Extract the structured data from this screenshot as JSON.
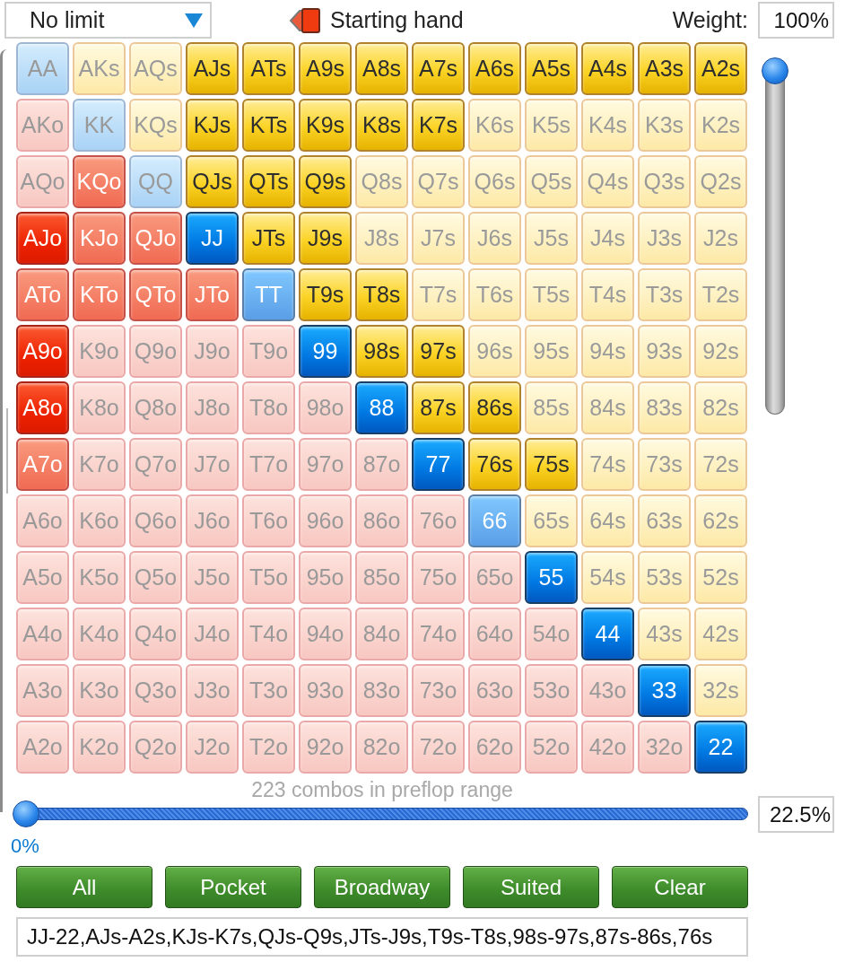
{
  "toolbar": {
    "game_dropdown": {
      "value": "No limit"
    },
    "title": "Starting hand",
    "weight": {
      "label": "Weight:",
      "value": "100%"
    }
  },
  "hand_grid": [
    [
      {
        "hand": "AA",
        "kind": "pair",
        "selected": false,
        "partial": false
      },
      {
        "hand": "AKs",
        "kind": "suited",
        "selected": false,
        "partial": false
      },
      {
        "hand": "AQs",
        "kind": "suited",
        "selected": false,
        "partial": false
      },
      {
        "hand": "AJs",
        "kind": "suited",
        "selected": true,
        "partial": false
      },
      {
        "hand": "ATs",
        "kind": "suited",
        "selected": true,
        "partial": false
      },
      {
        "hand": "A9s",
        "kind": "suited",
        "selected": true,
        "partial": false
      },
      {
        "hand": "A8s",
        "kind": "suited",
        "selected": true,
        "partial": false
      },
      {
        "hand": "A7s",
        "kind": "suited",
        "selected": true,
        "partial": false
      },
      {
        "hand": "A6s",
        "kind": "suited",
        "selected": true,
        "partial": false
      },
      {
        "hand": "A5s",
        "kind": "suited",
        "selected": true,
        "partial": false
      },
      {
        "hand": "A4s",
        "kind": "suited",
        "selected": true,
        "partial": false
      },
      {
        "hand": "A3s",
        "kind": "suited",
        "selected": true,
        "partial": false
      },
      {
        "hand": "A2s",
        "kind": "suited",
        "selected": true,
        "partial": false
      }
    ],
    [
      {
        "hand": "AKo",
        "kind": "offsuit",
        "selected": false,
        "partial": false
      },
      {
        "hand": "KK",
        "kind": "pair",
        "selected": false,
        "partial": false
      },
      {
        "hand": "KQs",
        "kind": "suited",
        "selected": false,
        "partial": false
      },
      {
        "hand": "KJs",
        "kind": "suited",
        "selected": true,
        "partial": false
      },
      {
        "hand": "KTs",
        "kind": "suited",
        "selected": true,
        "partial": false
      },
      {
        "hand": "K9s",
        "kind": "suited",
        "selected": true,
        "partial": false
      },
      {
        "hand": "K8s",
        "kind": "suited",
        "selected": true,
        "partial": false
      },
      {
        "hand": "K7s",
        "kind": "suited",
        "selected": true,
        "partial": false
      },
      {
        "hand": "K6s",
        "kind": "suited",
        "selected": false,
        "partial": false
      },
      {
        "hand": "K5s",
        "kind": "suited",
        "selected": false,
        "partial": false
      },
      {
        "hand": "K4s",
        "kind": "suited",
        "selected": false,
        "partial": false
      },
      {
        "hand": "K3s",
        "kind": "suited",
        "selected": false,
        "partial": false
      },
      {
        "hand": "K2s",
        "kind": "suited",
        "selected": false,
        "partial": false
      }
    ],
    [
      {
        "hand": "AQo",
        "kind": "offsuit",
        "selected": false,
        "partial": false
      },
      {
        "hand": "KQo",
        "kind": "offsuit",
        "selected": false,
        "partial": true
      },
      {
        "hand": "QQ",
        "kind": "pair",
        "selected": false,
        "partial": false
      },
      {
        "hand": "QJs",
        "kind": "suited",
        "selected": true,
        "partial": false
      },
      {
        "hand": "QTs",
        "kind": "suited",
        "selected": true,
        "partial": false
      },
      {
        "hand": "Q9s",
        "kind": "suited",
        "selected": true,
        "partial": false
      },
      {
        "hand": "Q8s",
        "kind": "suited",
        "selected": false,
        "partial": false
      },
      {
        "hand": "Q7s",
        "kind": "suited",
        "selected": false,
        "partial": false
      },
      {
        "hand": "Q6s",
        "kind": "suited",
        "selected": false,
        "partial": false
      },
      {
        "hand": "Q5s",
        "kind": "suited",
        "selected": false,
        "partial": false
      },
      {
        "hand": "Q4s",
        "kind": "suited",
        "selected": false,
        "partial": false
      },
      {
        "hand": "Q3s",
        "kind": "suited",
        "selected": false,
        "partial": false
      },
      {
        "hand": "Q2s",
        "kind": "suited",
        "selected": false,
        "partial": false
      }
    ],
    [
      {
        "hand": "AJo",
        "kind": "offsuit",
        "selected": true,
        "partial": false
      },
      {
        "hand": "KJo",
        "kind": "offsuit",
        "selected": false,
        "partial": true
      },
      {
        "hand": "QJo",
        "kind": "offsuit",
        "selected": false,
        "partial": true
      },
      {
        "hand": "JJ",
        "kind": "pair",
        "selected": true,
        "partial": false
      },
      {
        "hand": "JTs",
        "kind": "suited",
        "selected": true,
        "partial": false
      },
      {
        "hand": "J9s",
        "kind": "suited",
        "selected": true,
        "partial": false
      },
      {
        "hand": "J8s",
        "kind": "suited",
        "selected": false,
        "partial": false
      },
      {
        "hand": "J7s",
        "kind": "suited",
        "selected": false,
        "partial": false
      },
      {
        "hand": "J6s",
        "kind": "suited",
        "selected": false,
        "partial": false
      },
      {
        "hand": "J5s",
        "kind": "suited",
        "selected": false,
        "partial": false
      },
      {
        "hand": "J4s",
        "kind": "suited",
        "selected": false,
        "partial": false
      },
      {
        "hand": "J3s",
        "kind": "suited",
        "selected": false,
        "partial": false
      },
      {
        "hand": "J2s",
        "kind": "suited",
        "selected": false,
        "partial": false
      }
    ],
    [
      {
        "hand": "ATo",
        "kind": "offsuit",
        "selected": false,
        "partial": true
      },
      {
        "hand": "KTo",
        "kind": "offsuit",
        "selected": false,
        "partial": true
      },
      {
        "hand": "QTo",
        "kind": "offsuit",
        "selected": false,
        "partial": true
      },
      {
        "hand": "JTo",
        "kind": "offsuit",
        "selected": false,
        "partial": true
      },
      {
        "hand": "TT",
        "kind": "pair",
        "selected": false,
        "partial": true
      },
      {
        "hand": "T9s",
        "kind": "suited",
        "selected": true,
        "partial": false
      },
      {
        "hand": "T8s",
        "kind": "suited",
        "selected": true,
        "partial": false
      },
      {
        "hand": "T7s",
        "kind": "suited",
        "selected": false,
        "partial": false
      },
      {
        "hand": "T6s",
        "kind": "suited",
        "selected": false,
        "partial": false
      },
      {
        "hand": "T5s",
        "kind": "suited",
        "selected": false,
        "partial": false
      },
      {
        "hand": "T4s",
        "kind": "suited",
        "selected": false,
        "partial": false
      },
      {
        "hand": "T3s",
        "kind": "suited",
        "selected": false,
        "partial": false
      },
      {
        "hand": "T2s",
        "kind": "suited",
        "selected": false,
        "partial": false
      }
    ],
    [
      {
        "hand": "A9o",
        "kind": "offsuit",
        "selected": true,
        "partial": false
      },
      {
        "hand": "K9o",
        "kind": "offsuit",
        "selected": false,
        "partial": false
      },
      {
        "hand": "Q9o",
        "kind": "offsuit",
        "selected": false,
        "partial": false
      },
      {
        "hand": "J9o",
        "kind": "offsuit",
        "selected": false,
        "partial": false
      },
      {
        "hand": "T9o",
        "kind": "offsuit",
        "selected": false,
        "partial": false
      },
      {
        "hand": "99",
        "kind": "pair",
        "selected": true,
        "partial": false
      },
      {
        "hand": "98s",
        "kind": "suited",
        "selected": true,
        "partial": false
      },
      {
        "hand": "97s",
        "kind": "suited",
        "selected": true,
        "partial": false
      },
      {
        "hand": "96s",
        "kind": "suited",
        "selected": false,
        "partial": false
      },
      {
        "hand": "95s",
        "kind": "suited",
        "selected": false,
        "partial": false
      },
      {
        "hand": "94s",
        "kind": "suited",
        "selected": false,
        "partial": false
      },
      {
        "hand": "93s",
        "kind": "suited",
        "selected": false,
        "partial": false
      },
      {
        "hand": "92s",
        "kind": "suited",
        "selected": false,
        "partial": false
      }
    ],
    [
      {
        "hand": "A8o",
        "kind": "offsuit",
        "selected": true,
        "partial": false
      },
      {
        "hand": "K8o",
        "kind": "offsuit",
        "selected": false,
        "partial": false
      },
      {
        "hand": "Q8o",
        "kind": "offsuit",
        "selected": false,
        "partial": false
      },
      {
        "hand": "J8o",
        "kind": "offsuit",
        "selected": false,
        "partial": false
      },
      {
        "hand": "T8o",
        "kind": "offsuit",
        "selected": false,
        "partial": false
      },
      {
        "hand": "98o",
        "kind": "offsuit",
        "selected": false,
        "partial": false
      },
      {
        "hand": "88",
        "kind": "pair",
        "selected": true,
        "partial": false
      },
      {
        "hand": "87s",
        "kind": "suited",
        "selected": true,
        "partial": false
      },
      {
        "hand": "86s",
        "kind": "suited",
        "selected": true,
        "partial": false
      },
      {
        "hand": "85s",
        "kind": "suited",
        "selected": false,
        "partial": false
      },
      {
        "hand": "84s",
        "kind": "suited",
        "selected": false,
        "partial": false
      },
      {
        "hand": "83s",
        "kind": "suited",
        "selected": false,
        "partial": false
      },
      {
        "hand": "82s",
        "kind": "suited",
        "selected": false,
        "partial": false
      }
    ],
    [
      {
        "hand": "A7o",
        "kind": "offsuit",
        "selected": false,
        "partial": true
      },
      {
        "hand": "K7o",
        "kind": "offsuit",
        "selected": false,
        "partial": false
      },
      {
        "hand": "Q7o",
        "kind": "offsuit",
        "selected": false,
        "partial": false
      },
      {
        "hand": "J7o",
        "kind": "offsuit",
        "selected": false,
        "partial": false
      },
      {
        "hand": "T7o",
        "kind": "offsuit",
        "selected": false,
        "partial": false
      },
      {
        "hand": "97o",
        "kind": "offsuit",
        "selected": false,
        "partial": false
      },
      {
        "hand": "87o",
        "kind": "offsuit",
        "selected": false,
        "partial": false
      },
      {
        "hand": "77",
        "kind": "pair",
        "selected": true,
        "partial": false
      },
      {
        "hand": "76s",
        "kind": "suited",
        "selected": true,
        "partial": false
      },
      {
        "hand": "75s",
        "kind": "suited",
        "selected": true,
        "partial": false
      },
      {
        "hand": "74s",
        "kind": "suited",
        "selected": false,
        "partial": false
      },
      {
        "hand": "73s",
        "kind": "suited",
        "selected": false,
        "partial": false
      },
      {
        "hand": "72s",
        "kind": "suited",
        "selected": false,
        "partial": false
      }
    ],
    [
      {
        "hand": "A6o",
        "kind": "offsuit",
        "selected": false,
        "partial": false
      },
      {
        "hand": "K6o",
        "kind": "offsuit",
        "selected": false,
        "partial": false
      },
      {
        "hand": "Q6o",
        "kind": "offsuit",
        "selected": false,
        "partial": false
      },
      {
        "hand": "J6o",
        "kind": "offsuit",
        "selected": false,
        "partial": false
      },
      {
        "hand": "T6o",
        "kind": "offsuit",
        "selected": false,
        "partial": false
      },
      {
        "hand": "96o",
        "kind": "offsuit",
        "selected": false,
        "partial": false
      },
      {
        "hand": "86o",
        "kind": "offsuit",
        "selected": false,
        "partial": false
      },
      {
        "hand": "76o",
        "kind": "offsuit",
        "selected": false,
        "partial": false
      },
      {
        "hand": "66",
        "kind": "pair",
        "selected": false,
        "partial": true
      },
      {
        "hand": "65s",
        "kind": "suited",
        "selected": false,
        "partial": false
      },
      {
        "hand": "64s",
        "kind": "suited",
        "selected": false,
        "partial": false
      },
      {
        "hand": "63s",
        "kind": "suited",
        "selected": false,
        "partial": false
      },
      {
        "hand": "62s",
        "kind": "suited",
        "selected": false,
        "partial": false
      }
    ],
    [
      {
        "hand": "A5o",
        "kind": "offsuit",
        "selected": false,
        "partial": false
      },
      {
        "hand": "K5o",
        "kind": "offsuit",
        "selected": false,
        "partial": false
      },
      {
        "hand": "Q5o",
        "kind": "offsuit",
        "selected": false,
        "partial": false
      },
      {
        "hand": "J5o",
        "kind": "offsuit",
        "selected": false,
        "partial": false
      },
      {
        "hand": "T5o",
        "kind": "offsuit",
        "selected": false,
        "partial": false
      },
      {
        "hand": "95o",
        "kind": "offsuit",
        "selected": false,
        "partial": false
      },
      {
        "hand": "85o",
        "kind": "offsuit",
        "selected": false,
        "partial": false
      },
      {
        "hand": "75o",
        "kind": "offsuit",
        "selected": false,
        "partial": false
      },
      {
        "hand": "65o",
        "kind": "offsuit",
        "selected": false,
        "partial": false
      },
      {
        "hand": "55",
        "kind": "pair",
        "selected": true,
        "partial": false
      },
      {
        "hand": "54s",
        "kind": "suited",
        "selected": false,
        "partial": false
      },
      {
        "hand": "53s",
        "kind": "suited",
        "selected": false,
        "partial": false
      },
      {
        "hand": "52s",
        "kind": "suited",
        "selected": false,
        "partial": false
      }
    ],
    [
      {
        "hand": "A4o",
        "kind": "offsuit",
        "selected": false,
        "partial": false
      },
      {
        "hand": "K4o",
        "kind": "offsuit",
        "selected": false,
        "partial": false
      },
      {
        "hand": "Q4o",
        "kind": "offsuit",
        "selected": false,
        "partial": false
      },
      {
        "hand": "J4o",
        "kind": "offsuit",
        "selected": false,
        "partial": false
      },
      {
        "hand": "T4o",
        "kind": "offsuit",
        "selected": false,
        "partial": false
      },
      {
        "hand": "94o",
        "kind": "offsuit",
        "selected": false,
        "partial": false
      },
      {
        "hand": "84o",
        "kind": "offsuit",
        "selected": false,
        "partial": false
      },
      {
        "hand": "74o",
        "kind": "offsuit",
        "selected": false,
        "partial": false
      },
      {
        "hand": "64o",
        "kind": "offsuit",
        "selected": false,
        "partial": false
      },
      {
        "hand": "54o",
        "kind": "offsuit",
        "selected": false,
        "partial": false
      },
      {
        "hand": "44",
        "kind": "pair",
        "selected": true,
        "partial": false
      },
      {
        "hand": "43s",
        "kind": "suited",
        "selected": false,
        "partial": false
      },
      {
        "hand": "42s",
        "kind": "suited",
        "selected": false,
        "partial": false
      }
    ],
    [
      {
        "hand": "A3o",
        "kind": "offsuit",
        "selected": false,
        "partial": false
      },
      {
        "hand": "K3o",
        "kind": "offsuit",
        "selected": false,
        "partial": false
      },
      {
        "hand": "Q3o",
        "kind": "offsuit",
        "selected": false,
        "partial": false
      },
      {
        "hand": "J3o",
        "kind": "offsuit",
        "selected": false,
        "partial": false
      },
      {
        "hand": "T3o",
        "kind": "offsuit",
        "selected": false,
        "partial": false
      },
      {
        "hand": "93o",
        "kind": "offsuit",
        "selected": false,
        "partial": false
      },
      {
        "hand": "83o",
        "kind": "offsuit",
        "selected": false,
        "partial": false
      },
      {
        "hand": "73o",
        "kind": "offsuit",
        "selected": false,
        "partial": false
      },
      {
        "hand": "63o",
        "kind": "offsuit",
        "selected": false,
        "partial": false
      },
      {
        "hand": "53o",
        "kind": "offsuit",
        "selected": false,
        "partial": false
      },
      {
        "hand": "43o",
        "kind": "offsuit",
        "selected": false,
        "partial": false
      },
      {
        "hand": "33",
        "kind": "pair",
        "selected": true,
        "partial": false
      },
      {
        "hand": "32s",
        "kind": "suited",
        "selected": false,
        "partial": false
      }
    ],
    [
      {
        "hand": "A2o",
        "kind": "offsuit",
        "selected": false,
        "partial": false
      },
      {
        "hand": "K2o",
        "kind": "offsuit",
        "selected": false,
        "partial": false
      },
      {
        "hand": "Q2o",
        "kind": "offsuit",
        "selected": false,
        "partial": false
      },
      {
        "hand": "J2o",
        "kind": "offsuit",
        "selected": false,
        "partial": false
      },
      {
        "hand": "T2o",
        "kind": "offsuit",
        "selected": false,
        "partial": false
      },
      {
        "hand": "92o",
        "kind": "offsuit",
        "selected": false,
        "partial": false
      },
      {
        "hand": "82o",
        "kind": "offsuit",
        "selected": false,
        "partial": false
      },
      {
        "hand": "72o",
        "kind": "offsuit",
        "selected": false,
        "partial": false
      },
      {
        "hand": "62o",
        "kind": "offsuit",
        "selected": false,
        "partial": false
      },
      {
        "hand": "52o",
        "kind": "offsuit",
        "selected": false,
        "partial": false
      },
      {
        "hand": "42o",
        "kind": "offsuit",
        "selected": false,
        "partial": false
      },
      {
        "hand": "32o",
        "kind": "offsuit",
        "selected": false,
        "partial": false
      },
      {
        "hand": "22",
        "kind": "pair",
        "selected": true,
        "partial": false
      }
    ]
  ],
  "weight_slider": {
    "level": 1
  },
  "range": {
    "caption": "223 combos in preflop range",
    "slider": {
      "level": 0
    },
    "min_label": "0%",
    "value": "22.5%"
  },
  "buttons": [
    "All",
    "Pocket",
    "Broadway",
    "Suited",
    "Clear"
  ],
  "range_text": {
    "value": "JJ-22,AJs-A2s,KJs-K7s,QJs-Q9s,JTs-J9s,T9s-T8s,98s-97s,87s-86s,76s"
  }
}
